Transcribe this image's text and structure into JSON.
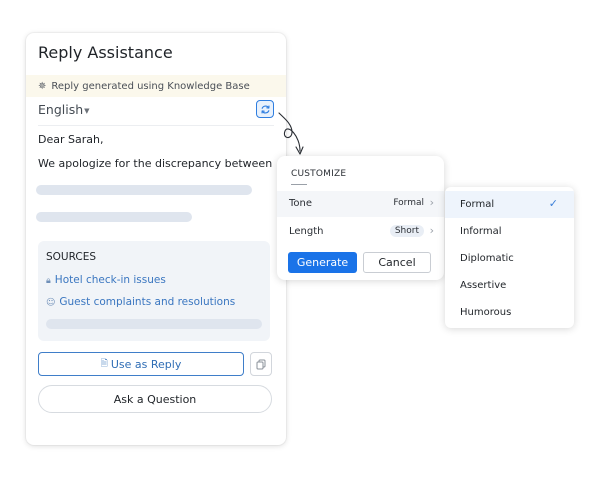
{
  "panel": {
    "title": "Reply Assistance",
    "kb_banner": "Reply generated using Knowledge Base",
    "language": "English",
    "greeting": "Dear Sarah,",
    "reply_line": "We apologize for the discrepancy between",
    "sources": {
      "title": "SOURCES",
      "items": [
        {
          "label": "Hotel check-in issues",
          "icon": "lock-icon"
        },
        {
          "label": "Guest complaints and resolutions",
          "icon": "person-icon"
        }
      ]
    },
    "use_reply_label": "Use as Reply",
    "ask_label": "Ask a Question"
  },
  "customize": {
    "title": "CUSTOMIZE",
    "rows": [
      {
        "label": "Tone",
        "value": "Formal"
      },
      {
        "label": "Length",
        "value": "Short"
      }
    ],
    "generate_label": "Generate",
    "cancel_label": "Cancel"
  },
  "tone_menu": {
    "options": [
      "Formal",
      "Informal",
      "Diplomatic",
      "Assertive",
      "Humorous"
    ],
    "selected": "Formal"
  },
  "colors": {
    "accent": "#1a73e8",
    "link": "#3a76c0",
    "banner_bg": "#fbf8ec",
    "skeleton": "#dfe5ee"
  }
}
